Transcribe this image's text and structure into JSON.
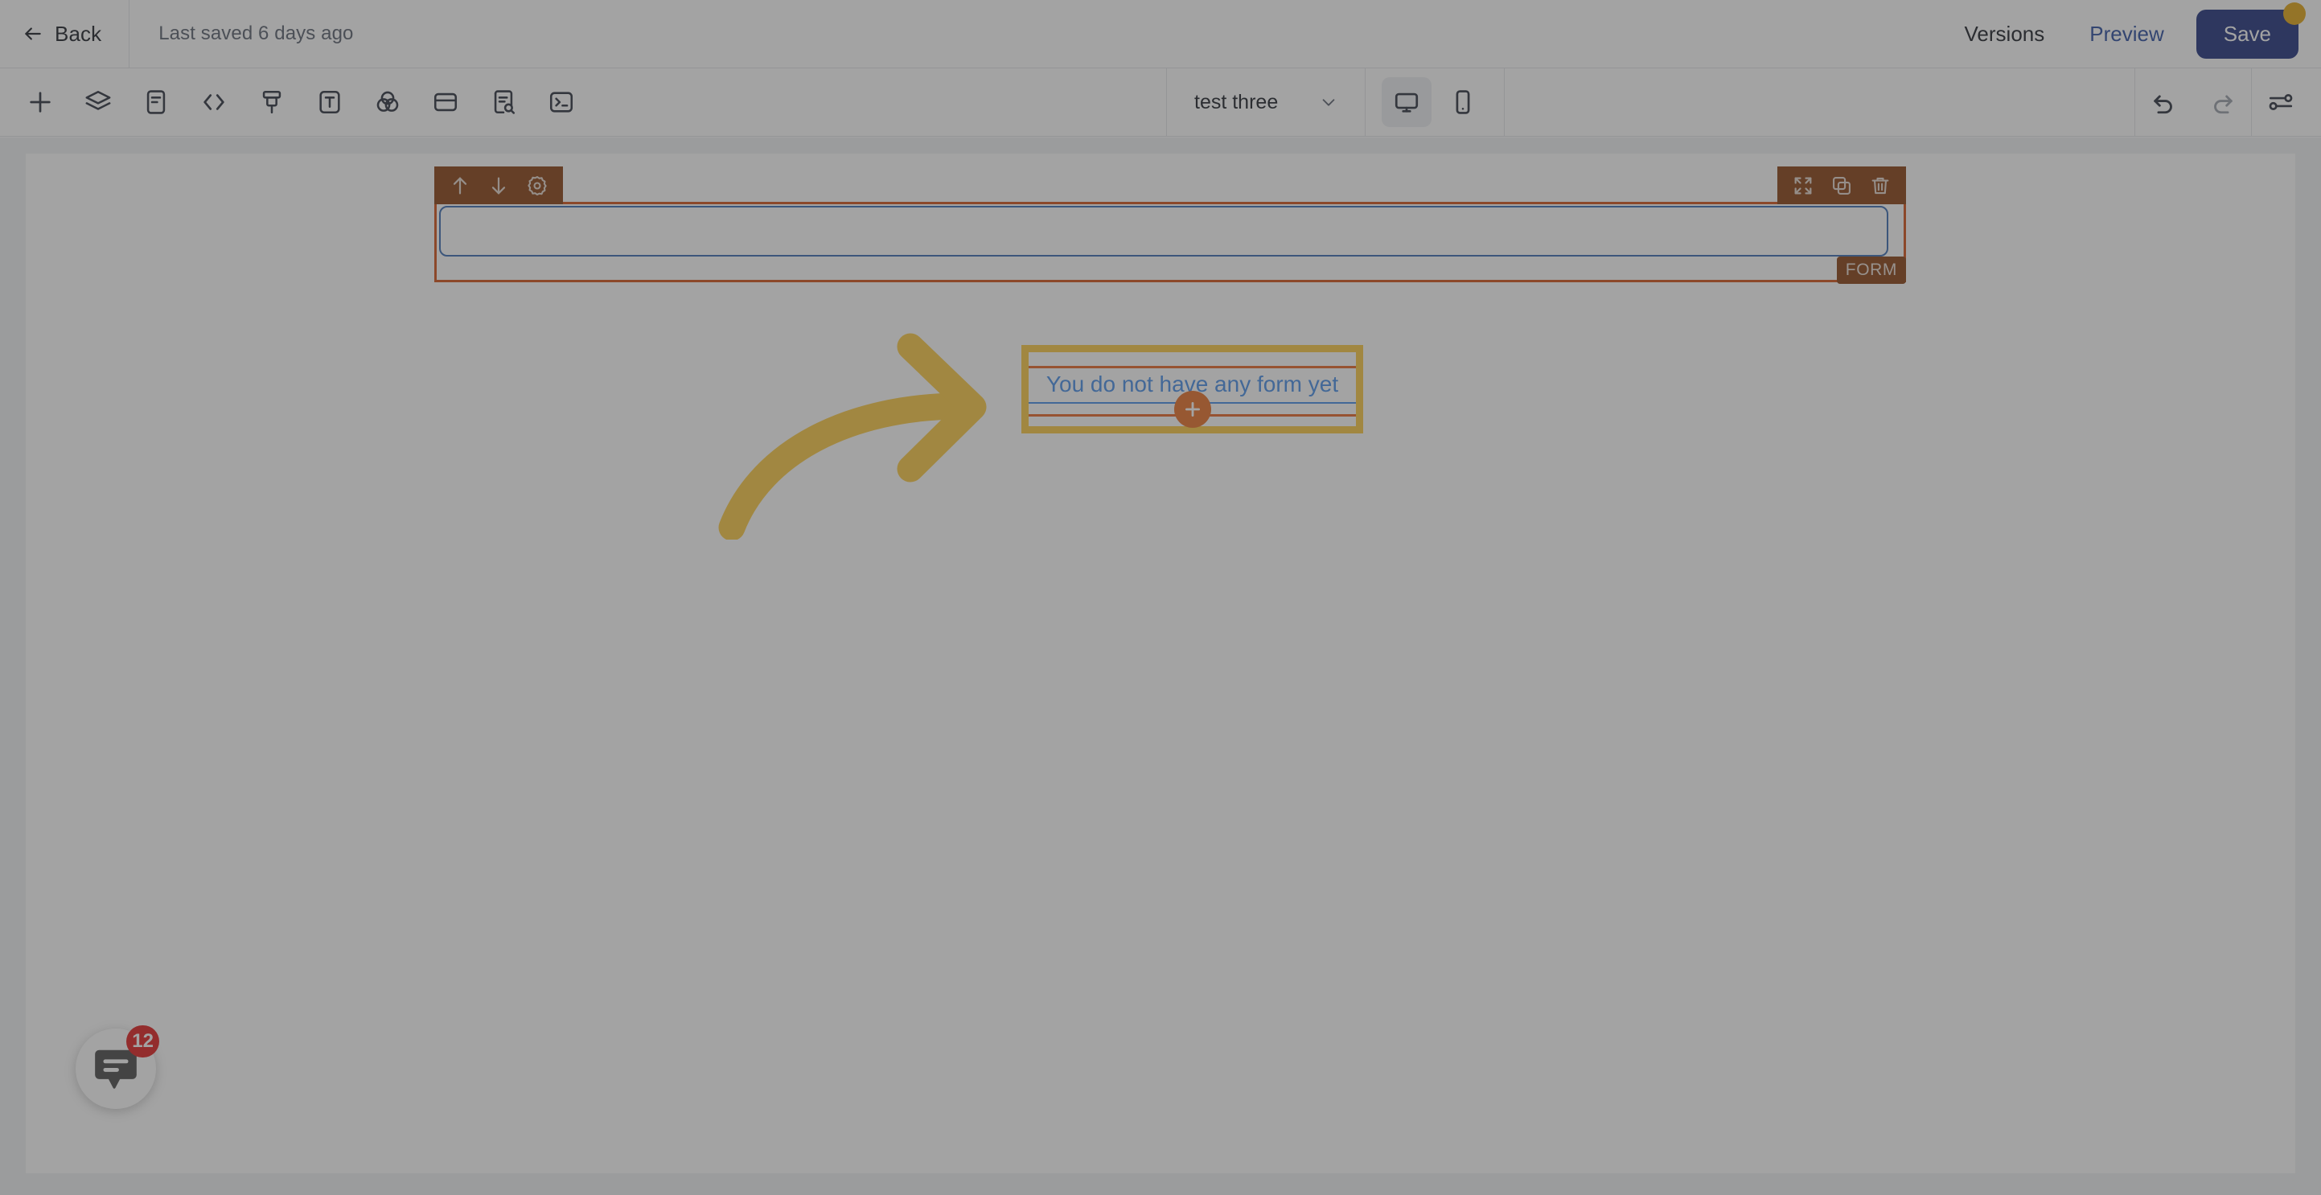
{
  "topbar": {
    "back_label": "Back",
    "back_icon": "arrow-left-icon",
    "saved_text": "Last saved 6 days ago",
    "versions_label": "Versions",
    "preview_label": "Preview",
    "save_label": "Save",
    "save_badge_color": "#e2a617",
    "preview_color": "#2c4fa0",
    "save_bg_color": "#22347f"
  },
  "toolbar": {
    "left_tools": [
      {
        "name": "add-icon",
        "title": "Add"
      },
      {
        "name": "layers-icon",
        "title": "Layers"
      },
      {
        "name": "document-icon",
        "title": "Pages"
      },
      {
        "name": "code-icon",
        "title": "Code"
      },
      {
        "name": "brush-icon",
        "title": "Styles"
      },
      {
        "name": "text-icon",
        "title": "Text"
      },
      {
        "name": "theme-icon",
        "title": "Theme"
      },
      {
        "name": "panel-icon",
        "title": "Layout"
      },
      {
        "name": "document-search-icon",
        "title": "SEO"
      },
      {
        "name": "terminal-icon",
        "title": "Console"
      }
    ],
    "page_select": {
      "value": "test three",
      "chevron_icon": "chevron-down-icon"
    },
    "devices": [
      {
        "name": "desktop-icon",
        "label": "Desktop",
        "active": true
      },
      {
        "name": "mobile-icon",
        "label": "Mobile",
        "active": false
      }
    ],
    "right_tools": [
      {
        "name": "undo-icon",
        "title": "Undo",
        "enabled": true
      },
      {
        "name": "redo-icon",
        "title": "Redo",
        "enabled": false
      },
      {
        "name": "settings-sliders-icon",
        "title": "Settings",
        "enabled": true
      }
    ]
  },
  "canvas": {
    "selected_block": {
      "tag_label": "FORM",
      "accent_color": "#d3541b",
      "control_bar_color": "#8a4216",
      "left_controls": [
        {
          "name": "move-up-icon",
          "title": "Move up"
        },
        {
          "name": "move-down-icon",
          "title": "Move down"
        },
        {
          "name": "gear-icon",
          "title": "Settings"
        }
      ],
      "right_controls": [
        {
          "name": "expand-icon",
          "title": "Expand"
        },
        {
          "name": "duplicate-icon",
          "title": "Duplicate"
        },
        {
          "name": "trash-icon",
          "title": "Delete"
        }
      ]
    },
    "highlight_box": {
      "message": "You do not have any form yet",
      "message_color": "#4a90e8",
      "highlight_color": "#fbcb46",
      "add_button": {
        "name": "add-form-icon",
        "color": "#e8722a"
      }
    },
    "annotation": {
      "name": "curved-arrow-annotation",
      "color": "#fbcb46"
    }
  },
  "chat_widget": {
    "icon": "chat-bubble-icon",
    "badge_count": "12",
    "badge_color": "#e02020"
  }
}
